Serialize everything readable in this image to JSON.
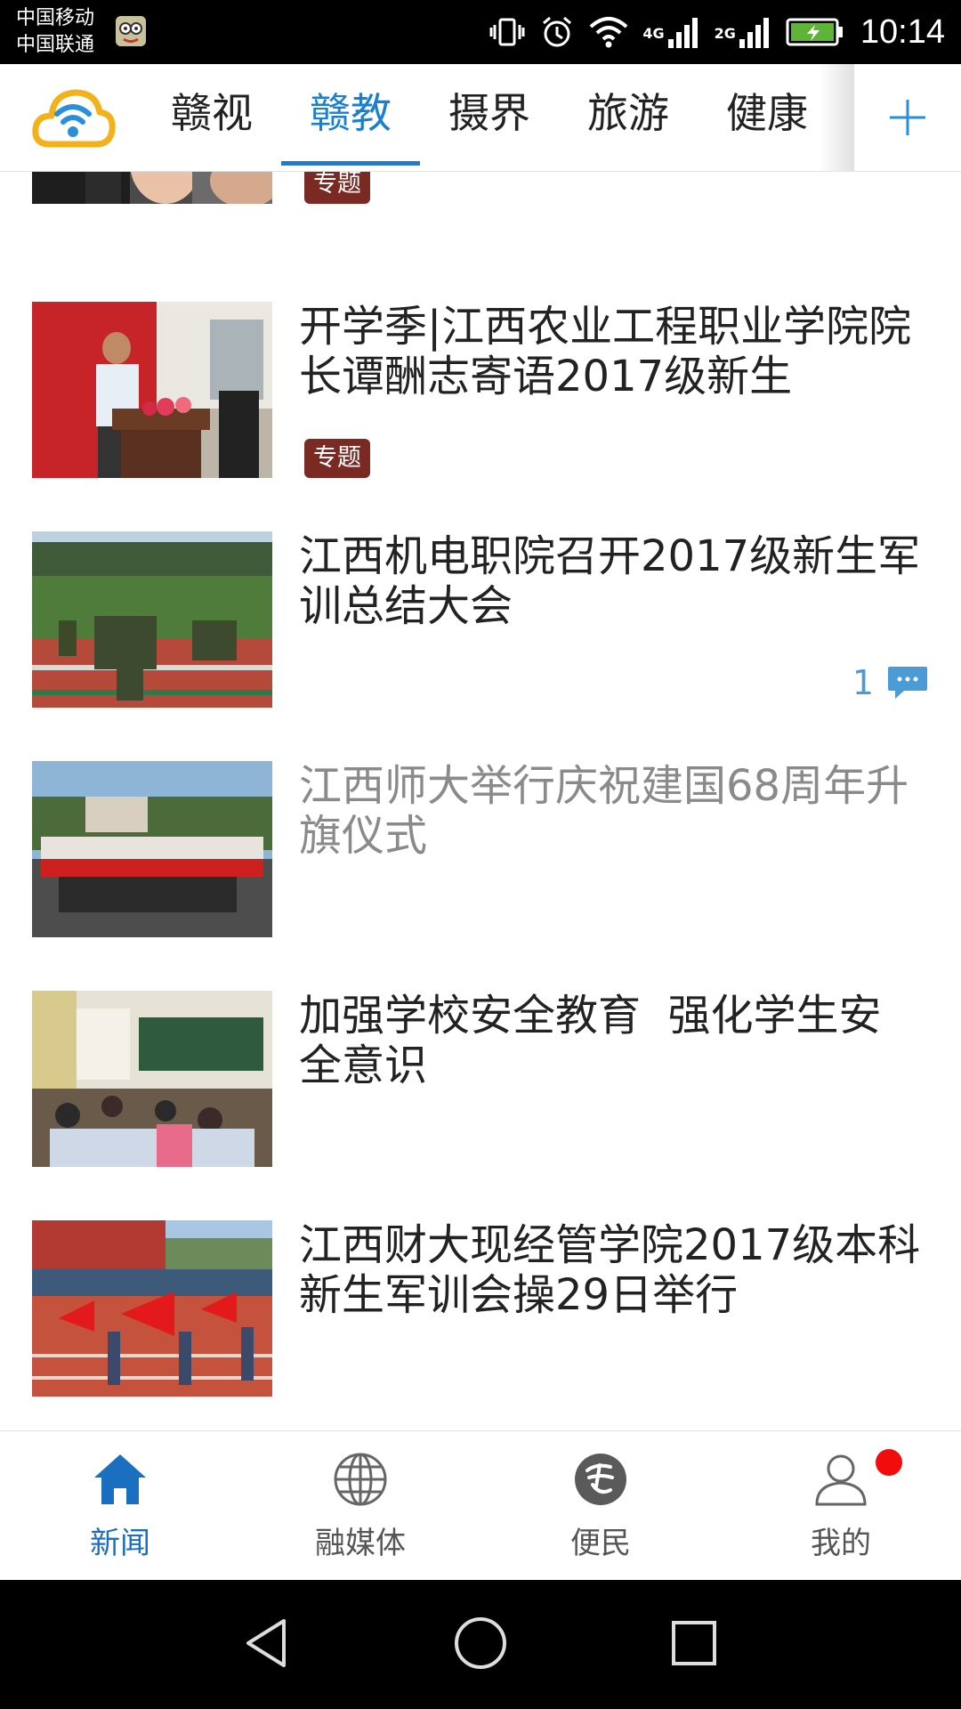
{
  "status_bar": {
    "carrier1": "中国移动",
    "carrier2": "中国联通",
    "net1": "4G",
    "net2": "2G",
    "time": "10:14"
  },
  "topbar": {
    "tabs": [
      {
        "label": "赣视"
      },
      {
        "label": "赣教"
      },
      {
        "label": "摄界"
      },
      {
        "label": "旅游"
      },
      {
        "label": "健康"
      }
    ],
    "active_tab": "赣教"
  },
  "news": {
    "partial_item": {
      "badge": "专题"
    },
    "items": [
      {
        "title": "开学季|江西农业工程职业学院院长谭酬志寄语2017级新生",
        "badge": "专题",
        "read": false
      },
      {
        "title": "江西机电职院召开2017级新生军训总结大会",
        "comments": "1",
        "read": false
      },
      {
        "title": "江西师大举行庆祝建国68周年升旗仪式",
        "read": true
      },
      {
        "title": "加强学校安全教育  强化学生安全意识",
        "read": false
      },
      {
        "title": "江西财大现经管学院2017级本科新生军训会操29日举行",
        "read": false
      }
    ]
  },
  "bottom_nav": {
    "items": [
      {
        "label": "新闻",
        "icon": "home-icon",
        "active": true
      },
      {
        "label": "融媒体",
        "icon": "globe-icon",
        "active": false
      },
      {
        "label": "便民",
        "icon": "service-icon",
        "active": false
      },
      {
        "label": "我的",
        "icon": "user-icon",
        "active": false,
        "notification": true
      }
    ]
  },
  "colors": {
    "accent": "#1a7fd0",
    "badge": "#7a2a22",
    "read_title": "#8a8a8a",
    "notification": "#f20c0c"
  }
}
